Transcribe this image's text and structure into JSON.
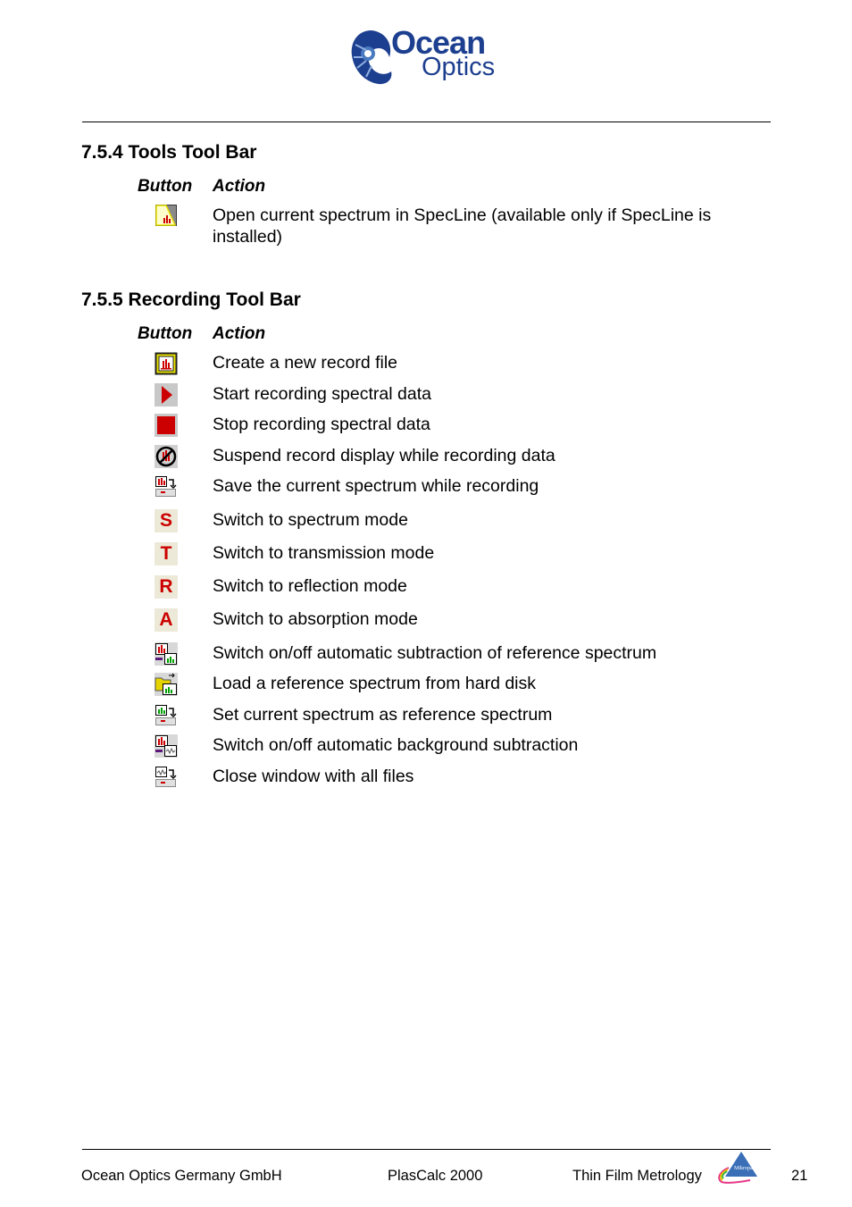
{
  "header": {
    "logo": {
      "line1": "Ocean",
      "line2": "Optics"
    }
  },
  "sections": [
    {
      "title": "7.5.4 Tools Tool Bar",
      "col_button": "Button",
      "col_action": "Action",
      "rows": [
        {
          "icon": "specline-icon",
          "action": "Open current spectrum in SpecLine (available only if SpecLine is installed)"
        }
      ]
    },
    {
      "title": "7.5.5 Recording Tool Bar",
      "col_button": "Button",
      "col_action": "Action",
      "rows": [
        {
          "icon": "new-record-file-icon",
          "action": "Create a new record file"
        },
        {
          "icon": "play-icon",
          "action": "Start recording spectral data"
        },
        {
          "icon": "stop-icon",
          "action": "Stop recording spectral data"
        },
        {
          "icon": "suspend-display-icon",
          "action": "Suspend record display while recording data"
        },
        {
          "icon": "save-spectrum-icon",
          "action": "Save the current spectrum while recording"
        },
        {
          "icon": "letter-s-icon",
          "glyph": "S",
          "action": "Switch to spectrum mode"
        },
        {
          "icon": "letter-t-icon",
          "glyph": "T",
          "action": "Switch to transmission mode"
        },
        {
          "icon": "letter-r-icon",
          "glyph": "R",
          "action": "Switch to reflection mode"
        },
        {
          "icon": "letter-a-icon",
          "glyph": "A",
          "action": "Switch to absorption mode"
        },
        {
          "icon": "reference-subtraction-icon",
          "action": "Switch on/off automatic subtraction of reference spectrum"
        },
        {
          "icon": "load-reference-icon",
          "action": "Load a reference spectrum from hard disk"
        },
        {
          "icon": "set-reference-icon",
          "action": "Set current spectrum as reference spectrum"
        },
        {
          "icon": "background-subtraction-icon",
          "action": "Switch on/off automatic background subtraction"
        },
        {
          "icon": "close-window-icon",
          "action": "Close window with all files"
        }
      ]
    }
  ],
  "footer": {
    "company": "Ocean Optics Germany GmbH",
    "product": "PlasCalc 2000",
    "tagline": "Thin Film Metrology",
    "page_number": "21",
    "partner_logo_text": "Mikropack"
  },
  "colors": {
    "brand_blue": "#1d3f8f",
    "icon_red": "#cc0000",
    "icon_green": "#00a000"
  }
}
